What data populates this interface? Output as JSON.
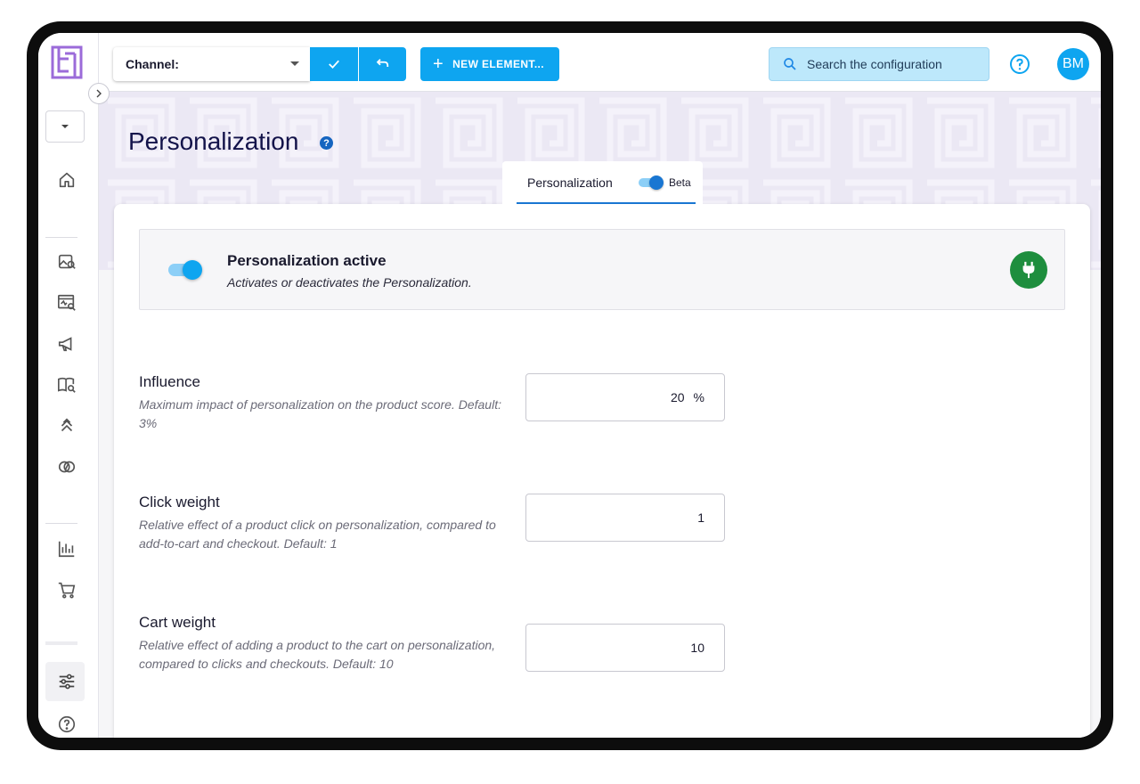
{
  "topbar": {
    "channel_label": "Channel:",
    "new_element_label": "NEW ELEMENT...",
    "search_placeholder": "Search the configuration",
    "avatar_initials": "BM"
  },
  "page": {
    "title": "Personalization",
    "tab_label": "Personalization",
    "beta_label": "Beta",
    "beta_enabled": true
  },
  "active_section": {
    "title": "Personalization active",
    "description": "Activates or deactivates the Personalization.",
    "enabled": true
  },
  "settings": [
    {
      "title": "Influence",
      "description": "Maximum impact of personalization on the product score. Default: 3%",
      "value": "20",
      "unit": "%"
    },
    {
      "title": "Click weight",
      "description": "Relative effect of a product click on personalization, compared to add-to-cart and checkout. Default: 1",
      "value": "1",
      "unit": ""
    },
    {
      "title": "Cart weight",
      "description": "Relative effect of adding a product to the cart on personalization, compared to clicks and checkouts. Default: 10",
      "value": "10",
      "unit": ""
    }
  ],
  "sidebar": {
    "icons": [
      "home-icon",
      "image-search-icon",
      "monitor-search-icon",
      "megaphone-icon",
      "book-search-icon",
      "double-chevron-up-icon",
      "intersect-circles-icon",
      "bar-chart-icon",
      "cart-icon",
      "sliders-icon",
      "help-icon"
    ]
  },
  "colors": {
    "accent": "#0ea5f0",
    "search_bg": "#bde8fb",
    "logo": "#9b6bd9",
    "header_band": "#ebe8f4",
    "status_green": "#1e8e3e",
    "title_color": "#13134a"
  }
}
